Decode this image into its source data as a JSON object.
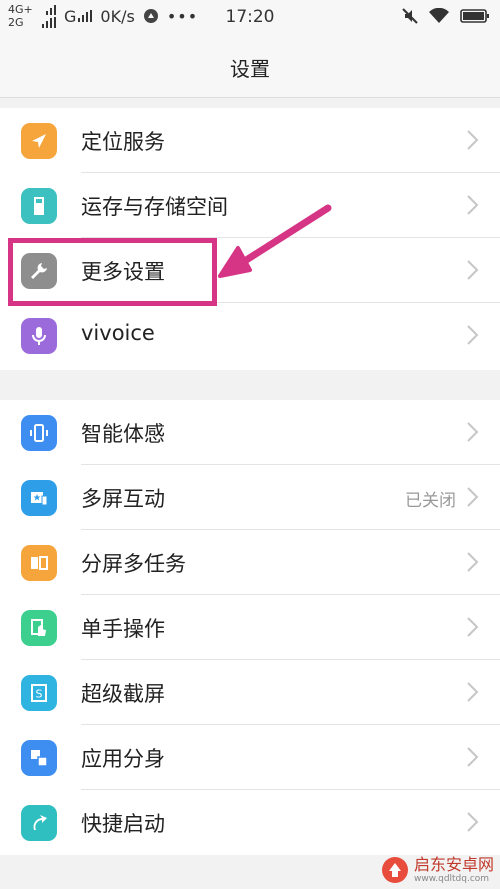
{
  "status_bar": {
    "network_top": "4G+",
    "network_bottom": "2G",
    "carrier2": "G",
    "speed": "0K/s",
    "more": "•••",
    "time": "17:20"
  },
  "header": {
    "title": "设置"
  },
  "group1": [
    {
      "label": "定位服务",
      "icon": "location-arrow-icon",
      "color": "#f6a53c"
    },
    {
      "label": "运存与存储空间",
      "icon": "sd-card-icon",
      "color": "#3cc0c0"
    },
    {
      "label": "更多设置",
      "icon": "wrench-icon",
      "color": "#8e8e8e"
    },
    {
      "label": "vivoice",
      "icon": "microphone-icon",
      "color": "#9b6bdb"
    }
  ],
  "group2": [
    {
      "label": "智能体感",
      "icon": "phone-motion-icon",
      "color": "#3d8ef0"
    },
    {
      "label": "多屏互动",
      "icon": "multi-screen-icon",
      "color": "#2f9ee8",
      "status": "已关闭"
    },
    {
      "label": "分屏多任务",
      "icon": "split-screen-icon",
      "color": "#f6a53c"
    },
    {
      "label": "单手操作",
      "icon": "one-hand-icon",
      "color": "#3ccf8e"
    },
    {
      "label": "超级截屏",
      "icon": "screenshot-icon",
      "color": "#2fb3e0"
    },
    {
      "label": "应用分身",
      "icon": "app-clone-icon",
      "color": "#3d8ef0"
    },
    {
      "label": "快捷启动",
      "icon": "quick-launch-icon",
      "color": "#2fbfc0"
    }
  ],
  "annotation": {
    "highlight_color": "#d63585"
  },
  "watermark": {
    "text": "启东安卓网",
    "url": "www.qdltdq.com"
  }
}
